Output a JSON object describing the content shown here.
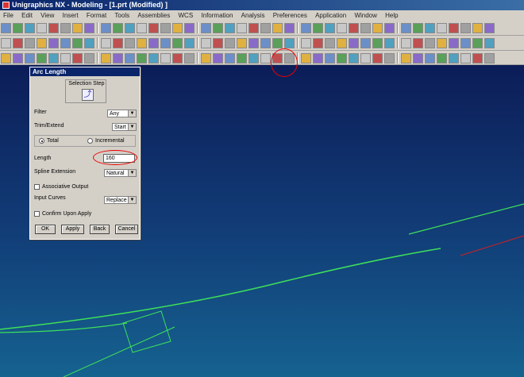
{
  "window": {
    "title": "Unigraphics NX - Modeling - [1.prt (Modified) ]"
  },
  "menu": [
    "File",
    "Edit",
    "View",
    "Insert",
    "Format",
    "Tools",
    "Assemblies",
    "WCS",
    "Information",
    "Analysis",
    "Preferences",
    "Application",
    "Window",
    "Help"
  ],
  "dialog": {
    "title": "Arc Length",
    "selection_step_label": "Selection Step",
    "filter_label": "Filter",
    "filter_value": "Any",
    "trim_extend_label": "Trim/Extend",
    "trim_extend_value": "Start",
    "radio_total": "Total",
    "radio_incremental": "Incremental",
    "length_label": "Length",
    "length_value": "160",
    "spline_extension_label": "Spline Extension",
    "spline_extension_value": "Natural",
    "associative_output_label": "Associative Output",
    "input_curves_label": "Input Curves",
    "input_curves_value": "Replace",
    "confirm_upon_apply_label": "Confirm Upon Apply",
    "ok_label": "OK",
    "apply_label": "Apply",
    "back_label": "Back",
    "cancel_label": "Cancel"
  },
  "colors": {
    "curve": "#3ee05a",
    "annotation": "#e01010",
    "dialog_title": "#0a246a"
  }
}
